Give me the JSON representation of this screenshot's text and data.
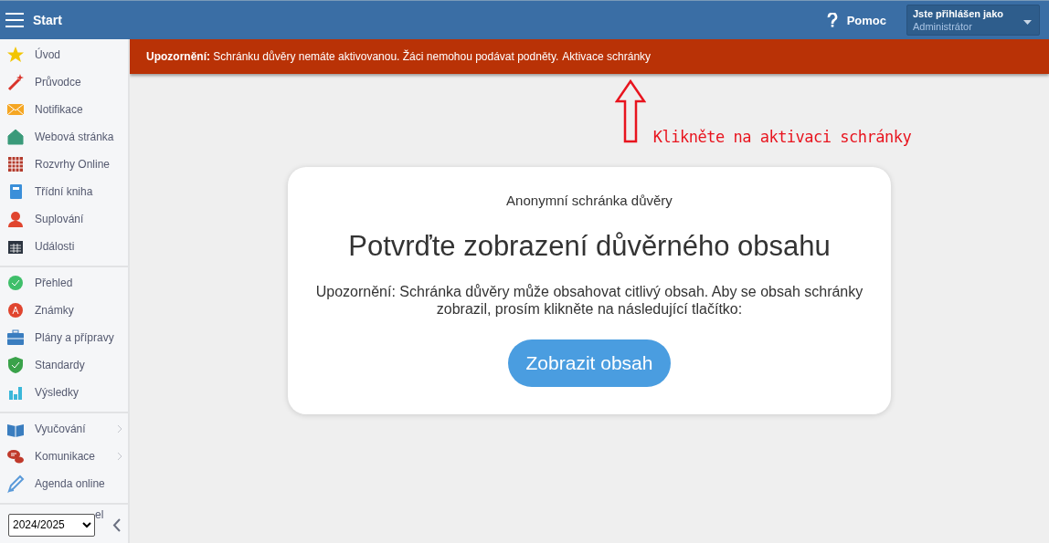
{
  "topbar": {
    "title": "Start",
    "help": "Pomoc",
    "user_label": "Jste přihlášen jako",
    "user_name": "Administrátor"
  },
  "sidebar": {
    "groups": [
      [
        {
          "label": "Úvod"
        },
        {
          "label": "Průvodce"
        },
        {
          "label": "Notifikace"
        },
        {
          "label": "Webová stránka"
        },
        {
          "label": "Rozvrhy Online"
        },
        {
          "label": "Třídní kniha"
        },
        {
          "label": "Suplování"
        },
        {
          "label": "Události"
        }
      ],
      [
        {
          "label": "Přehled"
        },
        {
          "label": "Známky"
        },
        {
          "label": "Plány a přípravy"
        },
        {
          "label": "Standardy"
        },
        {
          "label": "Výsledky"
        }
      ],
      [
        {
          "label": "Vyučování",
          "submenu": true
        },
        {
          "label": "Komunikace",
          "submenu": true
        },
        {
          "label": "Agenda online",
          "submenu": false
        }
      ]
    ],
    "hidden_item_tail": "el",
    "year": "2024/2025"
  },
  "banner": {
    "text": "**Upozornění:** Schránku důvěry nemáte aktivovanou. Žáci nemohou podávat podněty.",
    "link": "Aktivace schránky"
  },
  "annotation": {
    "text": "Klikněte na aktivaci schránky"
  },
  "card": {
    "subtitle": "Anonymní schránka důvěry",
    "title": "Potvrďte zobrazení důvěrného obsahu",
    "message": "Upozornění: Schránka důvěry může obsahovat citlivý obsah. Aby se obsah schránky zobrazil, prosím klikněte na následující tlačítko:",
    "button": "Zobrazit obsah"
  }
}
